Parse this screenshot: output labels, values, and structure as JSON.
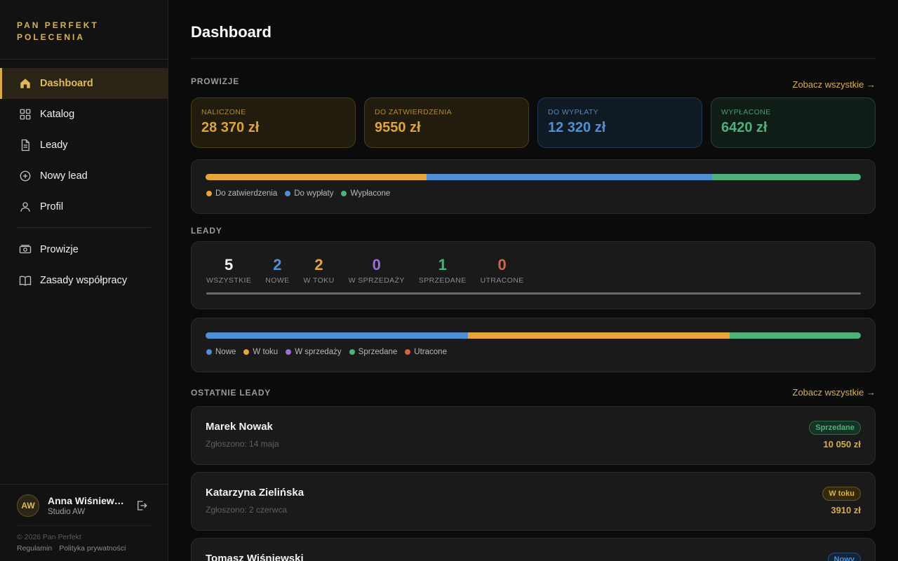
{
  "brand": "PAN PERFEKT\nPOLECENIA",
  "nav": [
    {
      "label": "Dashboard",
      "icon": "home-icon",
      "active": true
    },
    {
      "label": "Katalog",
      "icon": "grid-icon"
    },
    {
      "label": "Leady",
      "icon": "document-icon"
    },
    {
      "label": "Nowy lead",
      "icon": "plus-circle-icon"
    },
    {
      "label": "Profil",
      "icon": "user-icon"
    },
    {
      "label": "Prowizje",
      "icon": "money-icon"
    },
    {
      "label": "Zasady współpracy",
      "icon": "book-icon"
    }
  ],
  "user": {
    "initials": "AW",
    "name": "Anna Wiśniewska",
    "org": "Studio AW"
  },
  "footer": {
    "copyright": "© 2026 Pan Perfekt",
    "links": [
      "Regulamin",
      "Polityka prywatności"
    ]
  },
  "page_title": "Dashboard",
  "commissions": {
    "label": "PROWIZJE",
    "see_all": "Zobacz wszystkie →",
    "stats": [
      {
        "label": "NALICZONE",
        "value": "28 370 zł",
        "color": "#e0a33a"
      },
      {
        "label": "DO ZATWIERDZENIA",
        "value": "9550 zł",
        "color": "#e0a33a"
      },
      {
        "label": "DO WYPŁATY",
        "value": "12 320 zł",
        "color": "#4f8fd3"
      },
      {
        "label": "WYPŁACONE",
        "value": "6420 zł",
        "color": "#4fb07a"
      }
    ],
    "bar": [
      {
        "label": "Do zatwierdzenia",
        "value": 9550,
        "color": "#e8a53a"
      },
      {
        "label": "Do wypłaty",
        "value": 12320,
        "color": "#4f8fd3"
      },
      {
        "label": "Wypłacone",
        "value": 6420,
        "color": "#4fb07a"
      }
    ]
  },
  "leads": {
    "label": "LEADY",
    "counts": [
      {
        "label": "WSZYSTKIE",
        "value": "5",
        "color": "#f2f2f2"
      },
      {
        "label": "NOWE",
        "value": "2",
        "color": "#4f8fd3"
      },
      {
        "label": "W TOKU",
        "value": "2",
        "color": "#e8a53a"
      },
      {
        "label": "W SPRZEDAŻY",
        "value": "0",
        "color": "#9b6fd6"
      },
      {
        "label": "SPRZEDANE",
        "value": "1",
        "color": "#4fb07a"
      },
      {
        "label": "UTRACONE",
        "value": "0",
        "color": "#d0654a"
      }
    ],
    "bar": [
      {
        "label": "Nowe",
        "value": 2,
        "color": "#4f8fd3"
      },
      {
        "label": "W toku",
        "value": 2,
        "color": "#e8a53a"
      },
      {
        "label": "W sprzedaży",
        "value": 0,
        "color": "#9b6fd6"
      },
      {
        "label": "Sprzedane",
        "value": 1,
        "color": "#4fb07a"
      },
      {
        "label": "Utracone",
        "value": 0,
        "color": "#d0654a"
      }
    ]
  },
  "recent": {
    "label": "OSTATNIE LEADY",
    "see_all": "Zobacz wszystkie →",
    "items": [
      {
        "name": "Marek Nowak",
        "date": "Zgłoszono: 14 maja",
        "status": "Sprzedane",
        "status_color": "#4fb07a",
        "amount": "10 050 zł"
      },
      {
        "name": "Katarzyna Zielińska",
        "date": "Zgłoszono: 2 czerwca",
        "status": "W toku",
        "status_color": "#e0b040",
        "amount": "3910 zł"
      },
      {
        "name": "Tomasz Wiśniewski",
        "date": "",
        "status": "Nowy",
        "status_color": "#4f8fd3",
        "amount": ""
      }
    ]
  }
}
